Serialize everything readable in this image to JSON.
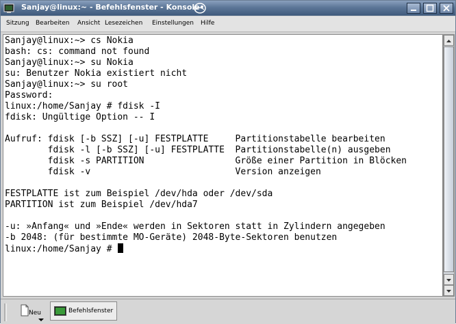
{
  "window": {
    "title": "Sanjay@linux:~ - Befehlsfenster - Konsole"
  },
  "menubar": {
    "items": [
      "Sitzung",
      "Bearbeiten",
      "Ansicht",
      "Lesezeichen",
      "Einstellungen",
      "Hilfe"
    ]
  },
  "terminal": {
    "lines": [
      "Sanjay@linux:~> cs Nokia",
      "bash: cs: command not found",
      "Sanjay@linux:~> su Nokia",
      "su: Benutzer Nokia existiert nicht",
      "Sanjay@linux:~> su root",
      "Password:",
      "linux:/home/Sanjay # fdisk -I",
      "fdisk: Ungültige Option -- I",
      "",
      "Aufruf: fdisk [-b SSZ] [-u] FESTPLATTE     Partitionstabelle bearbeiten",
      "        fdisk -l [-b SSZ] [-u] FESTPLATTE  Partitionstabelle(n) ausgeben",
      "        fdisk -s PARTITION                 Größe einer Partition in Blöcken",
      "        fdisk -v                           Version anzeigen",
      "",
      "FESTPLATTE ist zum Beispiel /dev/hda oder /dev/sda",
      "PARTITION ist zum Beispiel /dev/hda7",
      "",
      "-u: »Anfang« und »Ende« werden in Sektoren statt in Zylindern angegeben",
      "-b 2048: (für bestimmte MO-Geräte) 2048-Byte-Sektoren benutzen"
    ],
    "prompt": "linux:/home/Sanjay # "
  },
  "taskbar": {
    "new_label": "Neu",
    "task_label": "Befehlsfenster"
  },
  "icons": {
    "app": "konsole-icon",
    "suse": "suse-chameleon-icon",
    "minimize": "minimize-icon",
    "maximize": "maximize-icon",
    "close": "close-icon",
    "new_tab": "new-tab-icon",
    "terminal_task": "terminal-icon"
  },
  "colors": {
    "titlebar": "#5c7697",
    "terminal_bg": "#ffffff",
    "terminal_fg": "#000000"
  }
}
